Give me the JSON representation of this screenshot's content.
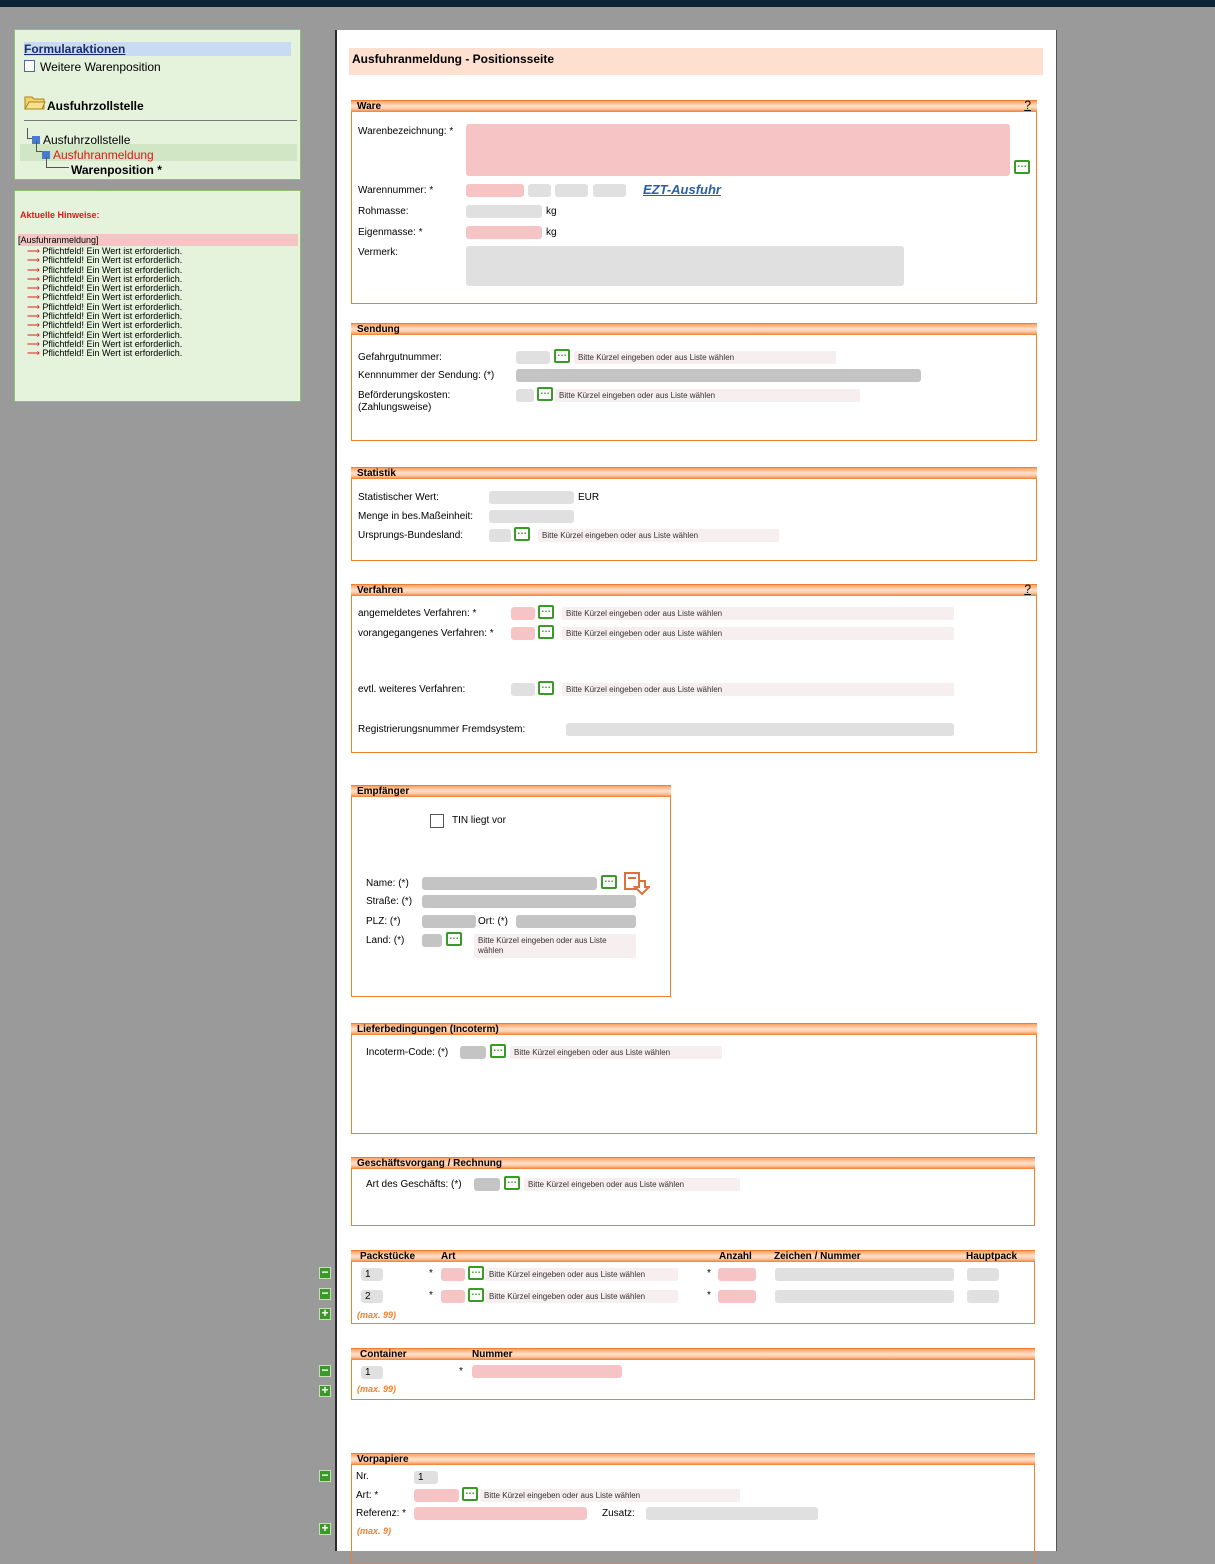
{
  "sidebar": {
    "actions_title": "Formularaktionen",
    "action_item": "Weitere Warenposition",
    "office_title": "Ausfuhrzollstelle",
    "tree": [
      "Ausfuhrzollstelle",
      "Ausfuhranmeldung",
      "Warenposition *"
    ]
  },
  "hints": {
    "title": "Aktuelle Hinweise:",
    "group": "[Ausfuhranmeldung]",
    "messages": [
      "Pflichtfeld! Ein Wert ist erforderlich.",
      "Pflichtfeld! Ein Wert ist erforderlich.",
      "Pflichtfeld! Ein Wert ist erforderlich.",
      "Pflichtfeld! Ein Wert ist erforderlich.",
      "Pflichtfeld! Ein Wert ist erforderlich.",
      "Pflichtfeld! Ein Wert ist erforderlich.",
      "Pflichtfeld! Ein Wert ist erforderlich.",
      "Pflichtfeld! Ein Wert ist erforderlich.",
      "Pflichtfeld! Ein Wert ist erforderlich.",
      "Pflichtfeld! Ein Wert ist erforderlich.",
      "Pflichtfeld! Ein Wert ist erforderlich.",
      "Pflichtfeld! Ein Wert ist erforderlich."
    ]
  },
  "page_title": "Ausfuhranmeldung - Positionsseite",
  "hint_text": "Bitte Kürzel eingeben oder aus Liste wählen",
  "ware": {
    "title": "Ware",
    "help": "?",
    "warenbezeichnung": "Warenbezeichnung: *",
    "warennummer": "Warennummer: *",
    "ezt_link": "EZT-Ausfuhr",
    "rohmasse": "Rohmasse:",
    "eigenmasse": "Eigenmasse: *",
    "unit_kg": "kg",
    "vermerk": "Vermerk:"
  },
  "sendung": {
    "title": "Sendung",
    "gefahrgut": "Gefahrgutnummer:",
    "kennnummer": "Kennnummer der Sendung: (*)",
    "befoerderung_1": "Beförderungskosten:",
    "befoerderung_2": "(Zahlungsweise)"
  },
  "statistik": {
    "title": "Statistik",
    "wert": "Statistischer Wert:",
    "eur": "EUR",
    "menge": "Menge in bes.Maßeinheit:",
    "bundesland": "Ursprungs-Bundesland:"
  },
  "verfahren": {
    "title": "Verfahren",
    "help": "?",
    "angemeldet": "angemeldetes Verfahren: *",
    "vorangegangen": "vorangegangenes Verfahren: *",
    "weiteres": "evtl. weiteres Verfahren:",
    "registrierung": "Registrierungsnummer Fremdsystem:"
  },
  "empfaenger": {
    "title": "Empfänger",
    "tin": "TIN liegt vor",
    "name": "Name: (*)",
    "strasse": "Straße: (*)",
    "plz": "PLZ: (*)",
    "ort": "Ort: (*)",
    "land": "Land: (*)",
    "land_hint_1": "Bitte Kürzel eingeben oder aus Liste",
    "land_hint_2": "wählen"
  },
  "lieferbedingungen": {
    "title": "Lieferbedingungen (Incoterm)",
    "code": "Incoterm-Code: (*)"
  },
  "geschaeft": {
    "title": "Geschäftsvorgang / Rechnung",
    "art": "Art des Geschäfts: (*)"
  },
  "packstuecke": {
    "cols": [
      "Packstücke",
      "Art",
      "Anzahl",
      "Zeichen / Nummer",
      "Hauptpack"
    ],
    "rows": [
      "1",
      "2"
    ],
    "star": "*",
    "max": "(max. 99)"
  },
  "container": {
    "cols": [
      "Container",
      "Nummer"
    ],
    "rows": [
      "1"
    ],
    "star": "*",
    "max": "(max. 99)"
  },
  "vorpapiere": {
    "title": "Vorpapiere",
    "nr": "Nr.",
    "nr_value": "1",
    "art": "Art: *",
    "referenz": "Referenz: *",
    "zusatz": "Zusatz:",
    "max": "(max. 9)"
  }
}
